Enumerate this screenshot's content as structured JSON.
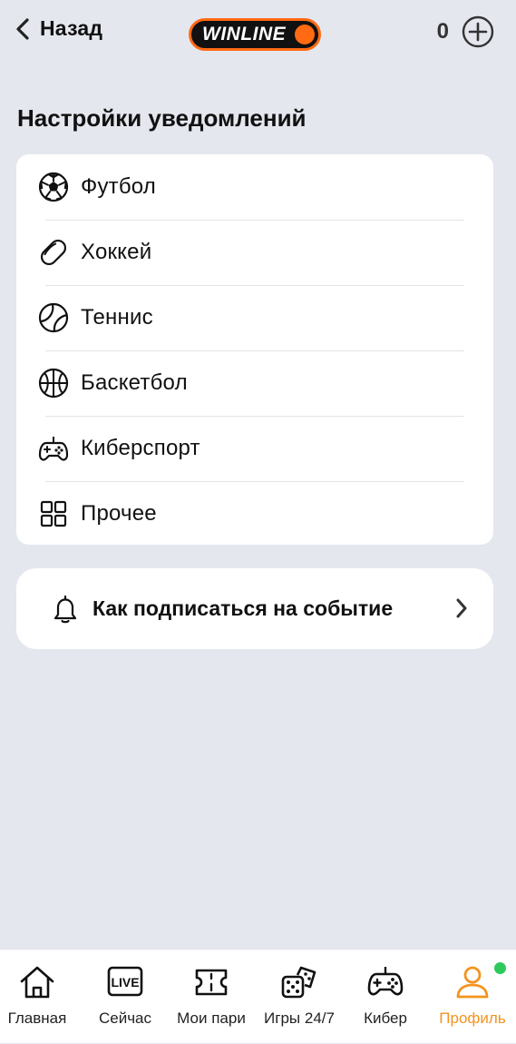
{
  "header": {
    "back_label": "Назад",
    "logo_text": "WINLINE",
    "balance": "0",
    "brand_color": "#ff6a13"
  },
  "page_title": "Настройки уведомлений",
  "sports": [
    {
      "label": "Футбол",
      "icon": "soccer-ball-icon"
    },
    {
      "label": "Хоккей",
      "icon": "hockey-puck-icon"
    },
    {
      "label": "Теннис",
      "icon": "tennis-ball-icon"
    },
    {
      "label": "Баскетбол",
      "icon": "basketball-icon"
    },
    {
      "label": "Киберспорт",
      "icon": "gamepad-icon"
    },
    {
      "label": "Прочее",
      "icon": "grid-icon"
    }
  ],
  "subscribe": {
    "label": "Как подписаться на событие",
    "icon": "bell-icon"
  },
  "tabbar": {
    "active_color": "#f4931e",
    "items": [
      {
        "label": "Главная",
        "icon": "home-icon"
      },
      {
        "label": "Сейчас",
        "icon": "live-icon",
        "badge": "LIVE"
      },
      {
        "label": "Мои пари",
        "icon": "ticket-icon"
      },
      {
        "label": "Игры 24/7",
        "icon": "dice-icon"
      },
      {
        "label": "Кибер",
        "icon": "gamepad-icon"
      },
      {
        "label": "Профиль",
        "icon": "user-icon",
        "active": true
      }
    ]
  }
}
